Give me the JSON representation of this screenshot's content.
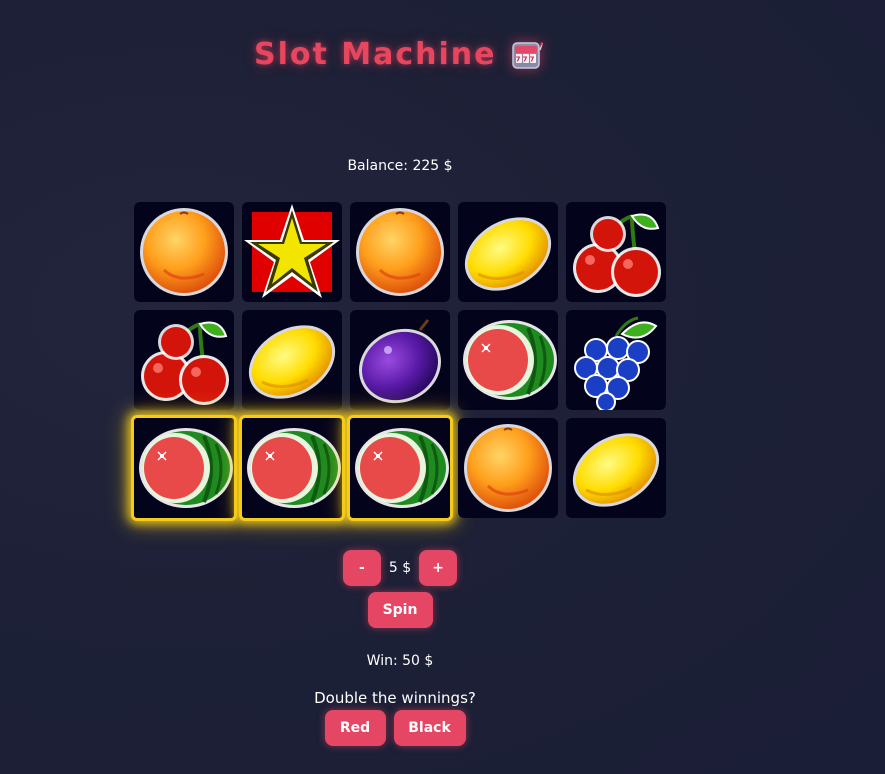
{
  "title": "Slot Machine",
  "title_icon": "slot-machine-icon",
  "balance_text": "Balance: 225 $",
  "reels": [
    [
      {
        "symbol": "orange",
        "highlighted": false
      },
      {
        "symbol": "star",
        "highlighted": false
      },
      {
        "symbol": "orange",
        "highlighted": false
      },
      {
        "symbol": "lemon",
        "highlighted": false
      },
      {
        "symbol": "cherry",
        "highlighted": false
      }
    ],
    [
      {
        "symbol": "cherry",
        "highlighted": false
      },
      {
        "symbol": "lemon",
        "highlighted": false
      },
      {
        "symbol": "plum",
        "highlighted": false
      },
      {
        "symbol": "watermelon",
        "highlighted": false
      },
      {
        "symbol": "grapes",
        "highlighted": false
      }
    ],
    [
      {
        "symbol": "watermelon",
        "highlighted": true
      },
      {
        "symbol": "watermelon",
        "highlighted": true
      },
      {
        "symbol": "watermelon",
        "highlighted": true
      },
      {
        "symbol": "orange",
        "highlighted": false
      },
      {
        "symbol": "lemon",
        "highlighted": false
      }
    ]
  ],
  "bet": {
    "decrease_label": "-",
    "value_text": "5 $",
    "increase_label": "+"
  },
  "spin_label": "Spin",
  "win_text": "Win: 50 $",
  "double": {
    "prompt": "Double the winnings?",
    "red_label": "Red",
    "black_label": "Black"
  },
  "colors": {
    "accent": "#e54663",
    "highlight": "#f5cc1a",
    "cell_bg": "#04031c"
  }
}
